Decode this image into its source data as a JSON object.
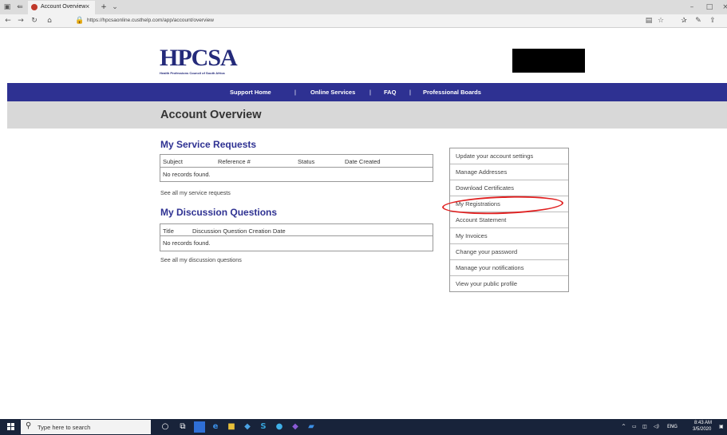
{
  "browser": {
    "tab_title": "Account Overview",
    "tab_close": "×",
    "new_tab": "+",
    "url": "https://hpcsaonline.custhelp.com/app/account/overview"
  },
  "logo": {
    "text": "HPCSA",
    "subtitle": "Health Professions Council of South Africa"
  },
  "nav": {
    "items": [
      "Support Home",
      "Online Services",
      "FAQ",
      "Professional Boards"
    ],
    "separator": "|"
  },
  "page": {
    "title": "Account Overview"
  },
  "service_requests": {
    "title": "My Service Requests",
    "columns": [
      "Subject",
      "Reference #",
      "Status",
      "Date Created"
    ],
    "empty_text": "No records found.",
    "link": "See all my service requests"
  },
  "discussion_questions": {
    "title": "My Discussion Questions",
    "columns": [
      "Title",
      "Discussion Question Creation Date"
    ],
    "empty_text": "No records found.",
    "link": "See all my discussion questions"
  },
  "account_menu": {
    "items": [
      "Update your account settings",
      "Manage Addresses",
      "Download Certificates",
      "My Registrations",
      "Account Statement",
      "My Invoices",
      "Change your password",
      "Manage your notifications",
      "View your public profile"
    ],
    "highlighted_index": 3,
    "highlight_color": "#e02020"
  },
  "colors": {
    "brand_navy": "#2e3192",
    "title_band": "#d8d8d8"
  },
  "taskbar": {
    "search_placeholder": "Type here to search",
    "language": "ENG",
    "time": "8:43 AM",
    "date": "3/5/2020"
  }
}
